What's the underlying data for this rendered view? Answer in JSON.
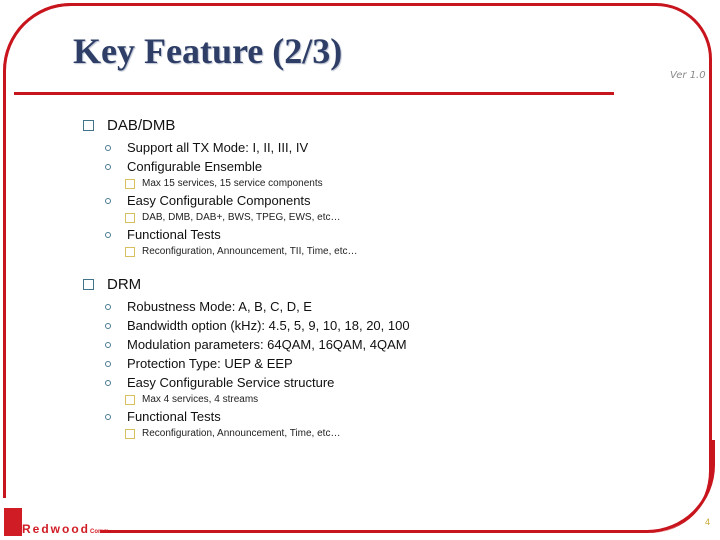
{
  "slide": {
    "title": "Key Feature (2/3)",
    "version": "Ver 1.0",
    "page_number": "4",
    "logo": {
      "main": "Redwood",
      "sub": "Comm"
    }
  },
  "sections": [
    {
      "heading": "DAB/DMB",
      "items": [
        {
          "text": "Support all TX Mode:  I, II, III, IV",
          "subitems": []
        },
        {
          "text": "Configurable Ensemble",
          "subitems": [
            "Max 15 services, 15 service components"
          ]
        },
        {
          "text": "Easy Configurable Components",
          "subitems": [
            "DAB, DMB, DAB+, BWS, TPEG, EWS, etc…"
          ]
        },
        {
          "text": "Functional Tests",
          "subitems": [
            "Reconfiguration, Announcement, TII, Time, etc…"
          ]
        }
      ]
    },
    {
      "heading": "DRM",
      "items": [
        {
          "text": "Robustness Mode: A, B, C, D, E",
          "subitems": []
        },
        {
          "text": "Bandwidth option (kHz): 4.5, 5, 9, 10, 18, 20, 100",
          "subitems": []
        },
        {
          "text": "Modulation parameters: 64QAM, 16QAM, 4QAM",
          "subitems": []
        },
        {
          "text": "Protection Type: UEP & EEP",
          "subitems": []
        },
        {
          "text": "Easy Configurable Service structure",
          "subitems": [
            "Max 4 services, 4 streams"
          ]
        },
        {
          "text": "Functional Tests",
          "subitems": [
            "Reconfiguration, Announcement, Time,  etc…"
          ]
        }
      ]
    }
  ]
}
